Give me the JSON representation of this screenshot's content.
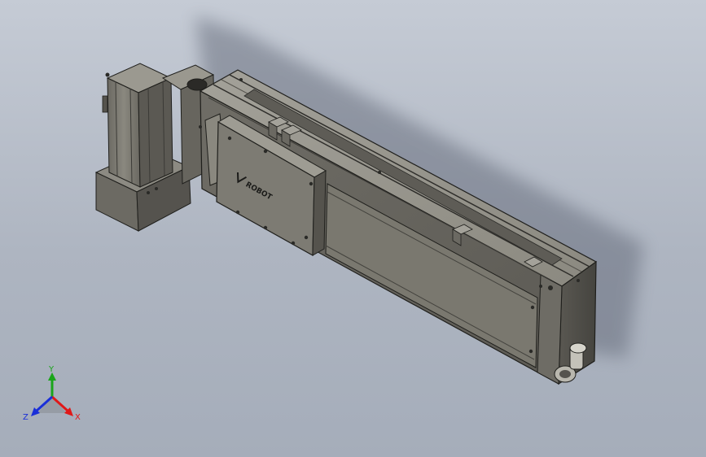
{
  "model": {
    "brand_logo_text": "ROBOT",
    "colors": {
      "background_top": "#c5cbd5",
      "background_bottom": "#a5adba",
      "body": "#75736c",
      "body_light": "#8e8c84",
      "body_dark": "#4b4a45",
      "edge": "#1f1f1c"
    }
  },
  "triad": {
    "x_label": "X",
    "y_label": "Y",
    "z_label": "Z",
    "x_color": "#e01818",
    "y_color": "#1aa51a",
    "z_color": "#1a2fd8"
  }
}
